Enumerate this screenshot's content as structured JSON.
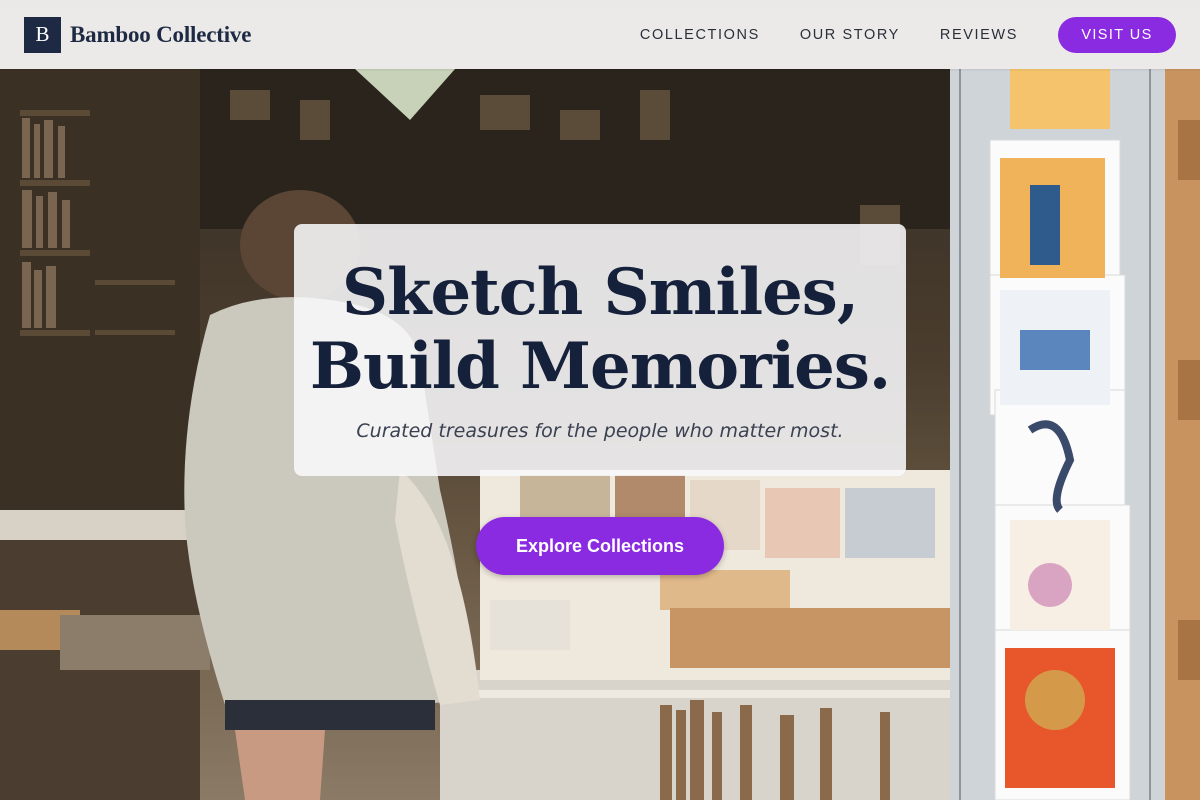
{
  "brand": {
    "logo_letter": "B",
    "name": "Bamboo Collective"
  },
  "nav": {
    "links": [
      "COLLECTIONS",
      "OUR STORY",
      "REVIEWS"
    ],
    "visit_label": "VISIT US"
  },
  "hero": {
    "title_line1": "Sketch Smiles,",
    "title_line2": "Build Memories.",
    "subtitle": "Curated treasures for the people who matter most.",
    "cta_label": "Explore Collections"
  },
  "colors": {
    "accent": "#8a2be2",
    "navy": "#1e2a44"
  }
}
